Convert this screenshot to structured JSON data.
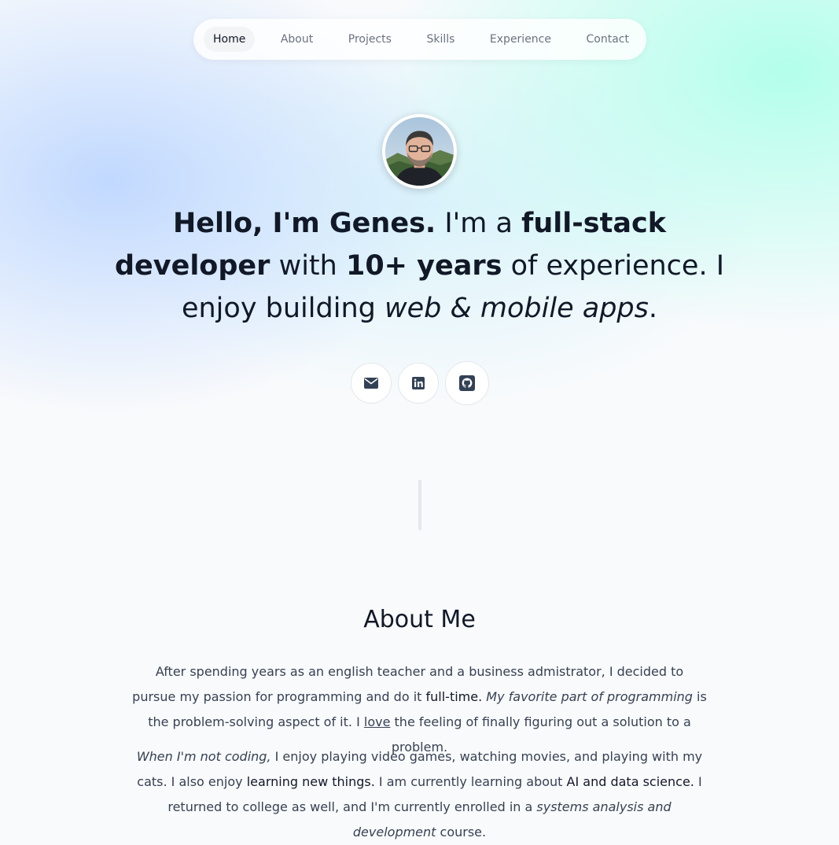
{
  "nav": {
    "items": [
      {
        "label": "Home",
        "active": true
      },
      {
        "label": "About"
      },
      {
        "label": "Projects"
      },
      {
        "label": "Skills"
      },
      {
        "label": "Experience"
      },
      {
        "label": "Contact"
      }
    ]
  },
  "hero": {
    "greeting": "Hello, I'm Genes.",
    "im_a": "I'm a",
    "role": "full-stack developer",
    "with": "with",
    "years": "10+ years",
    "experience_text": "of experience. I enjoy building",
    "apps": "web & mobile apps",
    "period": "."
  },
  "social": {
    "icons": [
      "envelope-icon",
      "linkedin-icon",
      "github-icon"
    ]
  },
  "about": {
    "title": "About Me",
    "p1": {
      "s1": "After spending years as an english teacher and a business admistrator, I decided to pursue my passion for programming and do it",
      "s2": "full-time.",
      "s3": "My favorite part of programming",
      "s4": "is the problem-solving aspect of it. I",
      "s5": "love",
      "s6": "the feeling of finally figuring out a solution to a problem."
    },
    "p2": {
      "s1": "When I'm not coding,",
      "s2": "I enjoy playing video games, watching movies, and playing with my cats. I also enjoy",
      "s3": "learning new things.",
      "s4": "I am currently learning about",
      "s5": "AI and data science.",
      "s6": "I returned to college as well, and I'm currently enrolled in a",
      "s7": "systems analysis and development",
      "s8": "course."
    }
  },
  "colors": {
    "text": "#111827",
    "muted": "#6b7280",
    "body_text": "#374151",
    "gradient_blue": "#bed7ff",
    "gradient_mint": "#afffeb"
  }
}
